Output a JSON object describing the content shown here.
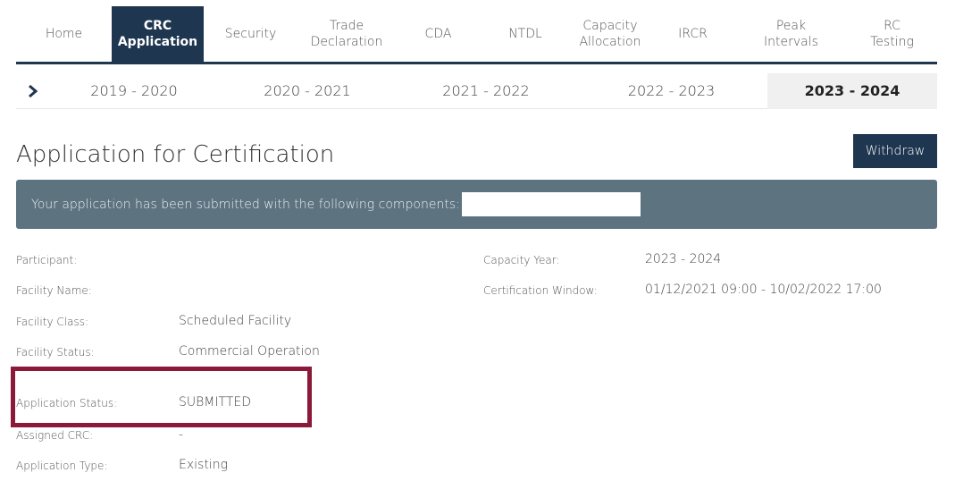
{
  "nav": {
    "items": [
      {
        "label": "Home"
      },
      {
        "label": "CRC\nApplication",
        "active": true
      },
      {
        "label": "Security"
      },
      {
        "label": "Trade\nDeclaration"
      },
      {
        "label": "CDA"
      },
      {
        "label": "NTDL"
      },
      {
        "label": "Capacity\nAllocation"
      },
      {
        "label": "IRCR"
      },
      {
        "label": "Peak\nIntervals"
      },
      {
        "label": "RC\nTesting"
      }
    ]
  },
  "years": {
    "arrow_icon": "chevron-right-icon",
    "items": [
      "2019 - 2020",
      "2020 - 2021",
      "2021 - 2022",
      "2022 - 2023",
      "2023 - 2024"
    ],
    "active": "2023 - 2024"
  },
  "page": {
    "title": "Application for Certification",
    "withdraw_label": "Withdraw"
  },
  "banner": {
    "text": "Your application has been submitted with the following components:"
  },
  "details": {
    "participant_label": "Participant:",
    "participant_value": "",
    "facility_name_label": "Facility Name:",
    "facility_name_value": "",
    "facility_class_label": "Facility Class:",
    "facility_class_value": "Scheduled Facility",
    "facility_status_label": "Facility Status:",
    "facility_status_value": "Commercial Operation",
    "application_status_label": "Application Status:",
    "application_status_value": "SUBMITTED",
    "assigned_crc_label": "Assigned CRC:",
    "assigned_crc_value": "-",
    "application_type_label": "Application Type:",
    "application_type_value": "Existing",
    "capacity_year_label": "Capacity Year:",
    "capacity_year_value": "2023 - 2024",
    "certification_window_label": "Certification Window:",
    "certification_window_value": "01/12/2021 09:00 - 10/02/2022 17:00"
  },
  "colors": {
    "nav_active": "#1e3650",
    "banner_bg": "#5d7380",
    "highlight_border": "#8b1a3a"
  }
}
